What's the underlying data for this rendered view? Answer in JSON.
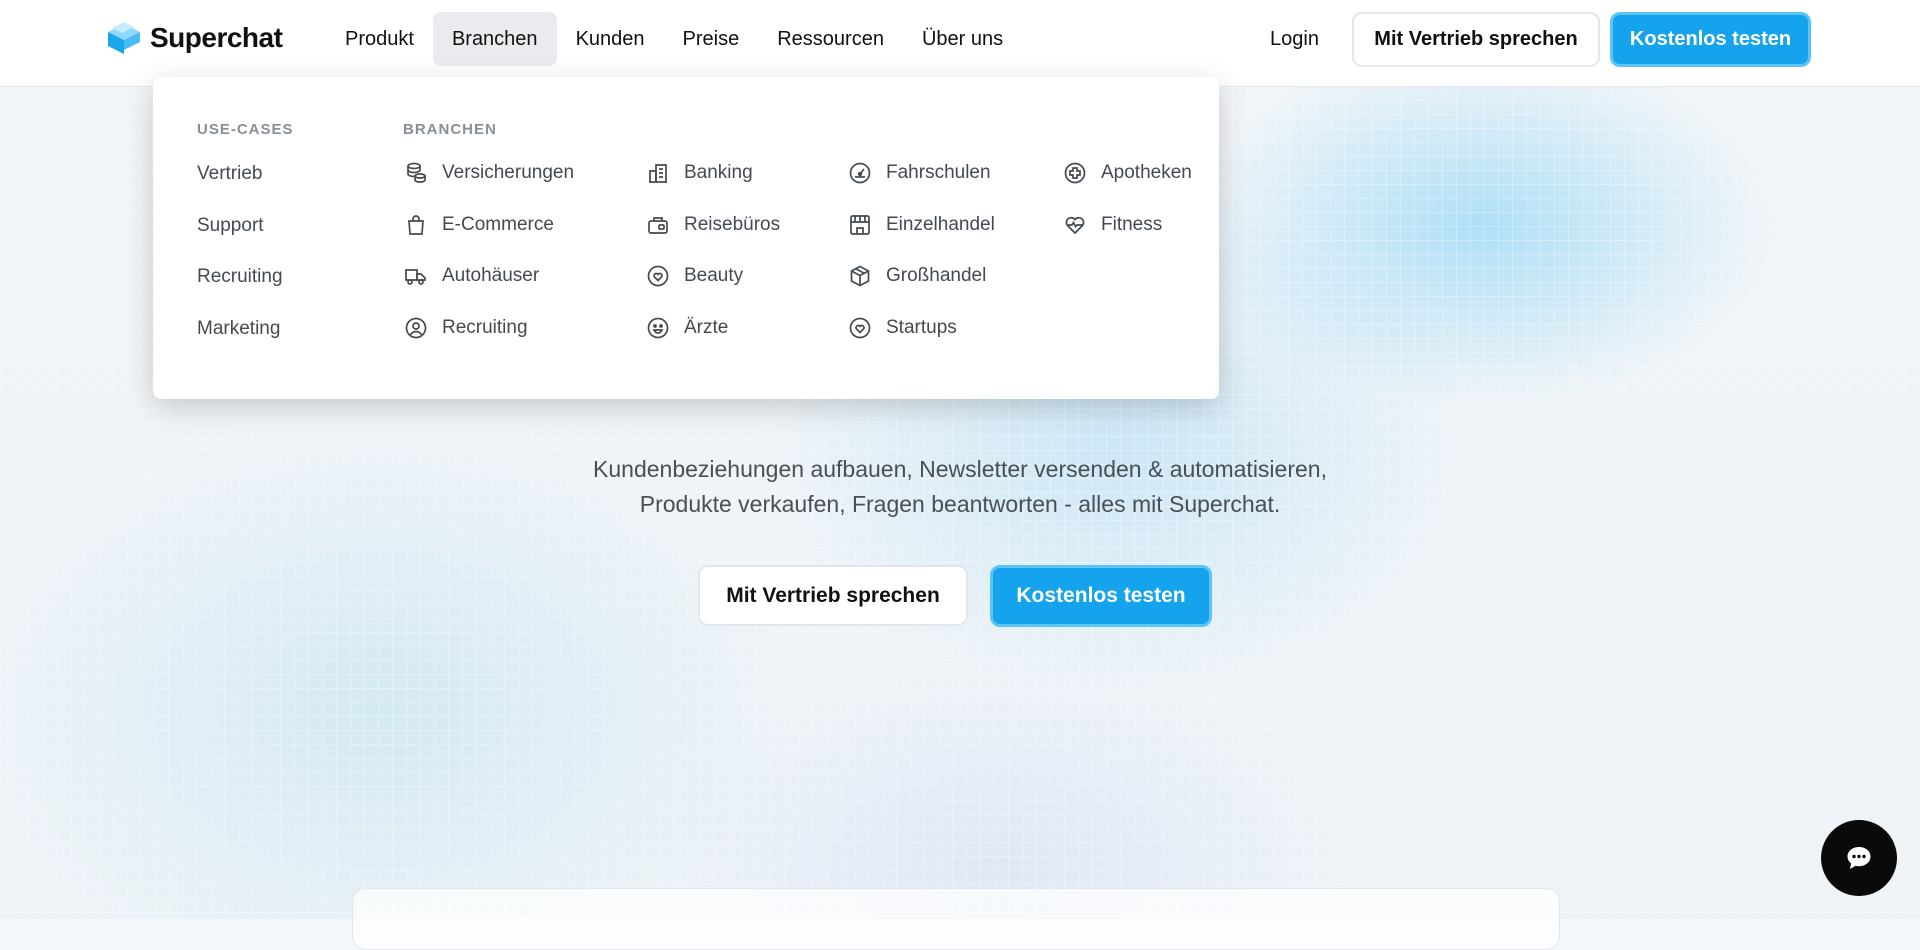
{
  "header": {
    "logo_text": "Superchat",
    "nav": [
      "Produkt",
      "Branchen",
      "Kunden",
      "Preise",
      "Ressourcen",
      "Über uns"
    ],
    "login": "Login",
    "sales_button": "Mit Vertrieb sprechen",
    "trial_button": "Kostenlos testen"
  },
  "dropdown": {
    "usecases_heading": "USE-CASES",
    "usecases": [
      "Vertrieb",
      "Support",
      "Recruiting",
      "Marketing"
    ],
    "industries_heading": "BRANCHEN",
    "industries": [
      {
        "label": "Versicherungen",
        "icon": "coins-icon"
      },
      {
        "label": "E-Commerce",
        "icon": "shopping-bag-icon"
      },
      {
        "label": "Autohäuser",
        "icon": "truck-icon"
      },
      {
        "label": "Recruiting",
        "icon": "user-circle-icon"
      },
      {
        "label": "Banking",
        "icon": "building-icon"
      },
      {
        "label": "Reisebüros",
        "icon": "wallet-icon"
      },
      {
        "label": "Beauty",
        "icon": "heart-circle-icon"
      },
      {
        "label": "Ärzte",
        "icon": "smiley-icon"
      },
      {
        "label": "Fahrschulen",
        "icon": "speedometer-icon"
      },
      {
        "label": "Einzelhandel",
        "icon": "store-icon"
      },
      {
        "label": "Großhandel",
        "icon": "package-icon"
      },
      {
        "label": "Startups",
        "icon": "heart-circle-icon"
      },
      {
        "label": "Apotheken",
        "icon": "medical-cross-icon"
      },
      {
        "label": "Fitness",
        "icon": "heart-pulse-icon"
      }
    ]
  },
  "hero": {
    "title_line1": "",
    "title_line2": "",
    "subtitle_line1": "Kundenbeziehungen aufbauen, Newsletter versenden & automatisieren,",
    "subtitle_line2": "Produkte verkaufen, Fragen beantworten - alles mit Superchat.",
    "sales_button": "Mit Vertrieb sprechen",
    "trial_button": "Kostenlos testen"
  },
  "chat_widget": {
    "icon": "chat-bubble-icon"
  },
  "colors": {
    "primary": "#14a3ec",
    "primary_border": "#5cc3f5",
    "text": "#111111"
  }
}
